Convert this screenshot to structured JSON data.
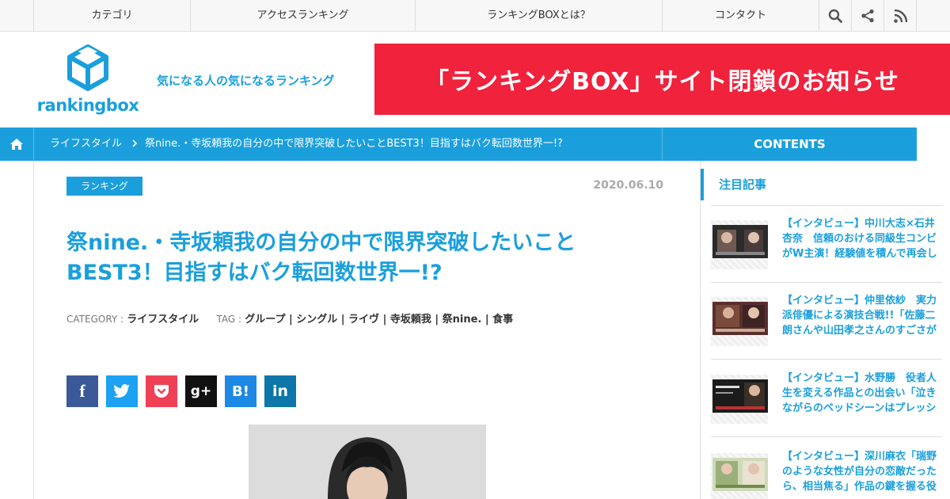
{
  "topnav": {
    "items": [
      "カテゴリ",
      "アクセスランキング",
      "ランキングBOXとは？",
      "コンタクト"
    ]
  },
  "header": {
    "logo_text": "rankingbox",
    "tagline": "気になる人の気になるランキング",
    "banner": "「ランキングBOX」サイト閉鎖のお知らせ"
  },
  "breadcrumb": {
    "category": "ライフスタイル",
    "separator": ">",
    "current": "祭nine.・寺坂頼我の自分の中で限界突破したいことBEST3！目指すはバク転回数世界一!?",
    "contents_label": "CONTENTS"
  },
  "article": {
    "badge": "ランキング",
    "date": "2020.06.10",
    "title": "祭nine.・寺坂頼我の自分の中で限界突破したいことBEST3！目指すはバク転回数世界一!?",
    "category_label": "CATEGORY :",
    "category_value": "ライフスタイル",
    "tag_label": "TAG :",
    "tags": "グループ | シングル | ライヴ | 寺坂頼我 | 祭nine. | 食事"
  },
  "share": {
    "facebook": "f",
    "twitter": "twitter",
    "pocket": "pocket",
    "googleplus": "g+",
    "hatena": "B!",
    "linkedin": "in"
  },
  "sidebar": {
    "heading": "注目記事",
    "items": [
      {
        "text": "【インタビュー】中川大志×石井杏奈　信頼のおける同級生コンビがW主演！経験値を積んで再会し"
      },
      {
        "text": "【インタビュー】仲里依紗　実力派俳優による演技合戦!!「佐藤二朗さんや山田孝之さんのすごさが"
      },
      {
        "text": "【インタビュー】水野勝　役者人生を変える作品との出会い「泣きながらのベッドシーンはプレッシ"
      },
      {
        "text": "【インタビュー】深川麻衣「瑞野のような女性が自分の恋敵だったら、相当焦る」作品の鍵を握る役"
      }
    ]
  },
  "colors": {
    "brand": "#1a9fdc",
    "banner": "#f0223c"
  }
}
